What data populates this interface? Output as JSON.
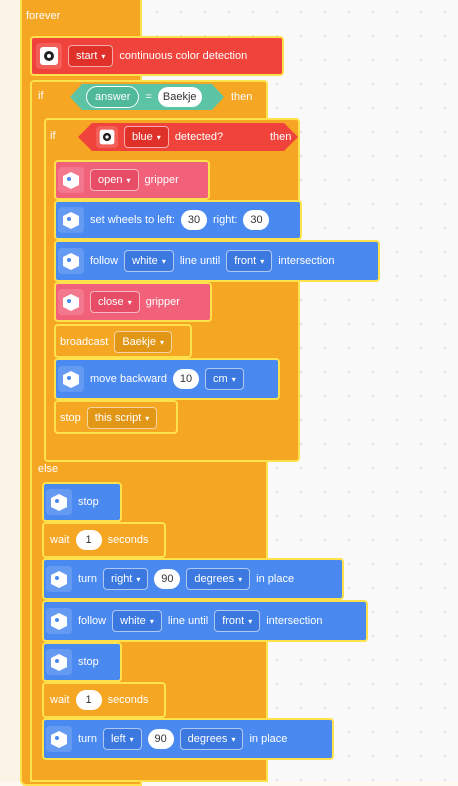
{
  "script": {
    "forever_label": "forever",
    "detect_block": {
      "mode": "start",
      "text": "continuous color detection"
    },
    "if_block": {
      "if_label": "if",
      "answer_label": "answer",
      "equals": "=",
      "value": "Baekje",
      "then_label": "then"
    },
    "inner_if": {
      "if_label": "if",
      "color": "blue",
      "detected_label": "detected?",
      "then_label": "then"
    },
    "open_gripper": {
      "mode": "open",
      "text": "gripper"
    },
    "set_wheels": {
      "text1": "set wheels to left:",
      "left": "30",
      "text2": "right:",
      "right": "30"
    },
    "follow1": {
      "text1": "follow",
      "color": "white",
      "text2": "line until",
      "where": "front",
      "text3": "intersection"
    },
    "close_gripper": {
      "mode": "close",
      "text": "gripper"
    },
    "broadcast": {
      "text": "broadcast",
      "message": "Baekje"
    },
    "move_backward": {
      "text": "move backward",
      "value": "10",
      "unit": "cm"
    },
    "stop_script": {
      "text": "stop",
      "option": "this script"
    },
    "else_label": "else",
    "stop1": {
      "text": "stop"
    },
    "wait1": {
      "text1": "wait",
      "value": "1",
      "text2": "seconds"
    },
    "turn1": {
      "text1": "turn",
      "dir": "right",
      "value": "90",
      "unit": "degrees",
      "text2": "in place"
    },
    "follow2": {
      "text1": "follow",
      "color": "white",
      "text2": "line until",
      "where": "front",
      "text3": "intersection"
    },
    "stop2": {
      "text": "stop"
    },
    "wait2": {
      "text1": "wait",
      "value": "1",
      "text2": "seconds"
    },
    "turn2": {
      "text1": "turn",
      "dir": "left",
      "value": "90",
      "unit": "degrees",
      "text2": "in place"
    }
  },
  "icons": {
    "robot": "robot-icon",
    "eye": "color-sensor-icon",
    "caret": "▾"
  },
  "colors": {
    "control": "#f5a623",
    "outline": "#ffe14d",
    "sensor": "#f0433c",
    "gripper": "#f2617a",
    "motion": "#4a89f0",
    "operator": "#5cc3a4"
  }
}
